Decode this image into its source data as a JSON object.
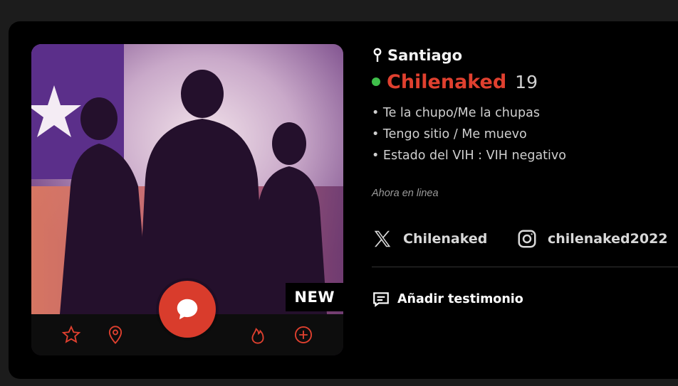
{
  "profile": {
    "location": "Santiago",
    "name": "Chilenaked",
    "age": "19",
    "badge": "NEW",
    "traits": [
      "Te la chupo/Me la chupas",
      "Tengo sitio / Me muevo",
      "Estado del VIH : VIH negativo"
    ],
    "online_status": "Ahora en linea"
  },
  "social": {
    "x_handle": "Chilenaked",
    "instagram_handle": "chilenaked2022"
  },
  "actions": {
    "add_testimonial": "Añadir testimonio"
  },
  "icons": {
    "location": "map-pin-icon",
    "x": "x-logo-icon",
    "instagram": "instagram-icon",
    "testimonial": "message-text-icon",
    "chat": "chat-bubble-icon",
    "favorite": "star-icon",
    "map": "location-pin-icon",
    "hot": "flame-icon",
    "add": "plus-circle-icon"
  },
  "colors": {
    "accent": "#e0402f",
    "online": "#3fbf4a",
    "background": "#000000"
  }
}
